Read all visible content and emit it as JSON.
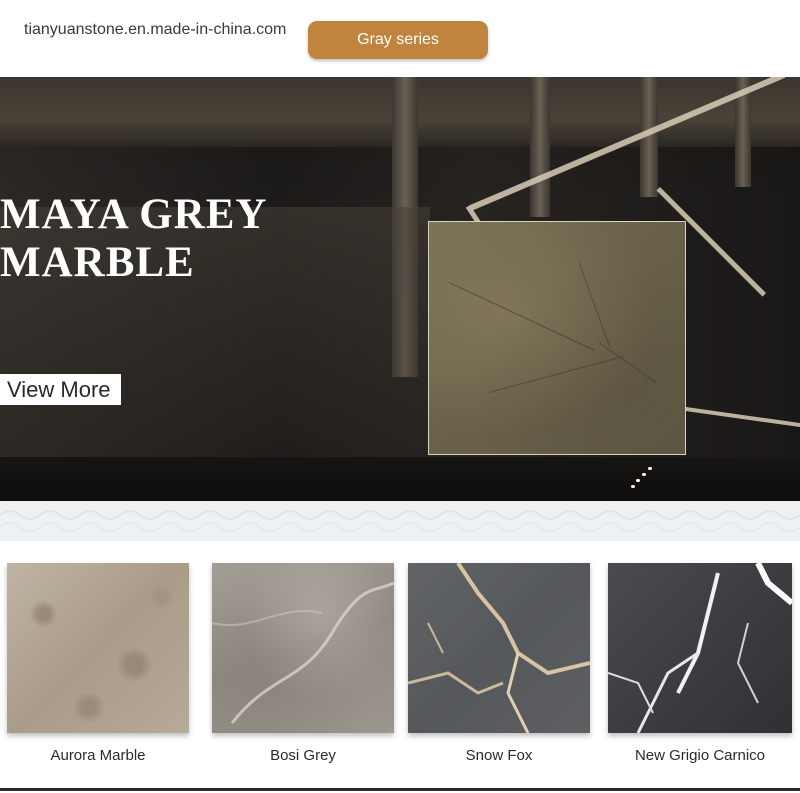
{
  "header": {
    "site_url": "tianyuanstone.en.made-in-china.com",
    "category_button": "Gray series",
    "accent_color": "#c0843f"
  },
  "hero": {
    "title_line1": "MAYA GREY",
    "title_line2": "MARBLE",
    "cta_label": "View More"
  },
  "products": [
    {
      "name": "Aurora Marble"
    },
    {
      "name": "Bosi Grey"
    },
    {
      "name": "Snow Fox"
    },
    {
      "name": "New Grigio Carnico"
    }
  ]
}
